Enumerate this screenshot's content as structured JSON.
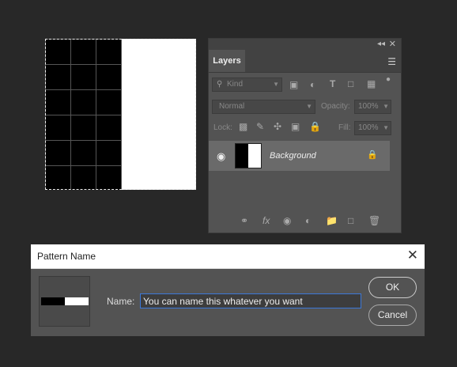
{
  "layers_panel": {
    "collapse_icon": "double-chevron-icon",
    "close_icon": "close-icon",
    "tab_label": "Layers",
    "menu_icon": "hamburger-icon",
    "filter": {
      "icon": "search-icon",
      "value": "Kind"
    },
    "blend_mode": "Normal",
    "opacity_label": "Opacity:",
    "opacity_value": "100%",
    "lock_label": "Lock:",
    "fill_label": "Fill:",
    "fill_value": "100%",
    "layer": {
      "name": "Background",
      "visible": true,
      "locked": true
    }
  },
  "dialog": {
    "title": "Pattern Name",
    "name_label": "Name:",
    "name_value": "You can name this whatever you want",
    "ok_label": "OK",
    "cancel_label": "Cancel"
  }
}
